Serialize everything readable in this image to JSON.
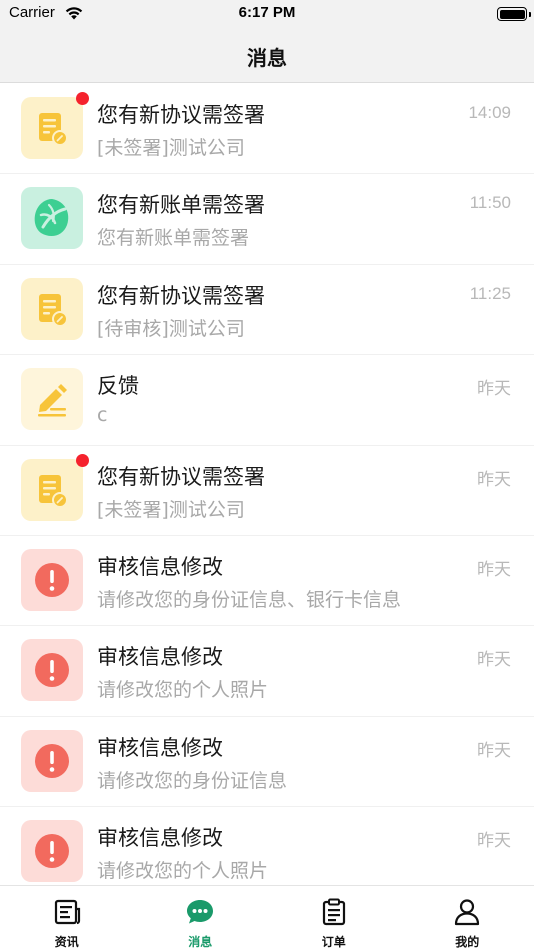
{
  "status_bar": {
    "carrier": "Carrier",
    "time": "6:17 PM"
  },
  "nav": {
    "title": "消息"
  },
  "messages": [
    {
      "title": "您有新协议需签署",
      "subtitle": "[未签署]测试公司",
      "time": "14:09",
      "icon": "document-sign-icon",
      "unread": true
    },
    {
      "title": "您有新账单需签署",
      "subtitle": "您有新账单需签署",
      "time": "11:50",
      "icon": "bill-leaf-icon",
      "unread": false
    },
    {
      "title": "您有新协议需签署",
      "subtitle": "[待审核]测试公司",
      "time": "11:25",
      "icon": "document-sign-icon",
      "unread": false
    },
    {
      "title": "反馈",
      "subtitle": "c",
      "time": "昨天",
      "icon": "feedback-pen-icon",
      "unread": false
    },
    {
      "title": "您有新协议需签署",
      "subtitle": "[未签署]测试公司",
      "time": "昨天",
      "icon": "document-sign-icon",
      "unread": true
    },
    {
      "title": "审核信息修改",
      "subtitle": "请修改您的身份证信息、银行卡信息",
      "time": "昨天",
      "icon": "alert-icon",
      "unread": false
    },
    {
      "title": "审核信息修改",
      "subtitle": "请修改您的个人照片",
      "time": "昨天",
      "icon": "alert-icon",
      "unread": false
    },
    {
      "title": "审核信息修改",
      "subtitle": "请修改您的身份证信息",
      "time": "昨天",
      "icon": "alert-icon",
      "unread": false
    },
    {
      "title": "审核信息修改",
      "subtitle": "请修改您的个人照片",
      "time": "昨天",
      "icon": "alert-icon",
      "unread": false
    }
  ],
  "tabs": [
    {
      "label": "资讯",
      "icon": "news-icon",
      "active": false
    },
    {
      "label": "消息",
      "icon": "chat-bubble-icon",
      "active": true
    },
    {
      "label": "订单",
      "icon": "clipboard-icon",
      "active": false
    },
    {
      "label": "我的",
      "icon": "person-icon",
      "active": false
    }
  ],
  "colors": {
    "accent": "#1a9a6a",
    "unread_dot": "#f5222d",
    "yellow_icon": "#f7c43a",
    "red_icon": "#f26a5e",
    "green_icon": "#3dcf92"
  }
}
